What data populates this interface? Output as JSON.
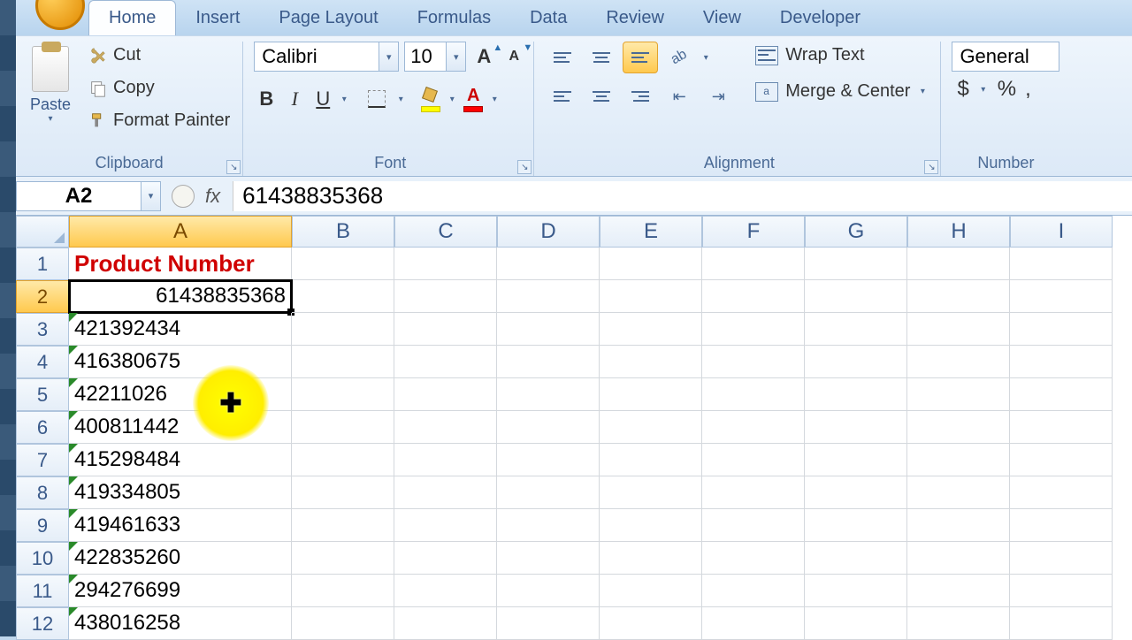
{
  "tabs": [
    "Home",
    "Insert",
    "Page Layout",
    "Formulas",
    "Data",
    "Review",
    "View",
    "Developer"
  ],
  "active_tab": "Home",
  "clipboard": {
    "paste": "Paste",
    "cut": "Cut",
    "copy": "Copy",
    "format_painter": "Format Painter",
    "group_label": "Clipboard"
  },
  "font": {
    "name": "Calibri",
    "size": "10",
    "group_label": "Font"
  },
  "alignment": {
    "wrap": "Wrap Text",
    "merge": "Merge & Center",
    "group_label": "Alignment"
  },
  "number": {
    "format": "General",
    "group_label": "Number",
    "currency": "$",
    "percent": "%",
    "comma": ","
  },
  "namebox": "A2",
  "formula_fx": "fx",
  "formula_value": "61438835368",
  "columns": [
    "A",
    "B",
    "C",
    "D",
    "E",
    "F",
    "G",
    "H",
    "I"
  ],
  "row_numbers": [
    "1",
    "2",
    "3",
    "4",
    "5",
    "6",
    "7",
    "8",
    "9",
    "10",
    "11",
    "12"
  ],
  "header_cell": "Product Number",
  "selected_value": "61438835368",
  "data_rows": [
    "421392434",
    "416380675",
    "42211026",
    "400811442",
    "415298484",
    "419334805",
    "419461633",
    "422835260",
    "294276699",
    "438016258"
  ],
  "selected_col": 0,
  "selected_row": 1
}
